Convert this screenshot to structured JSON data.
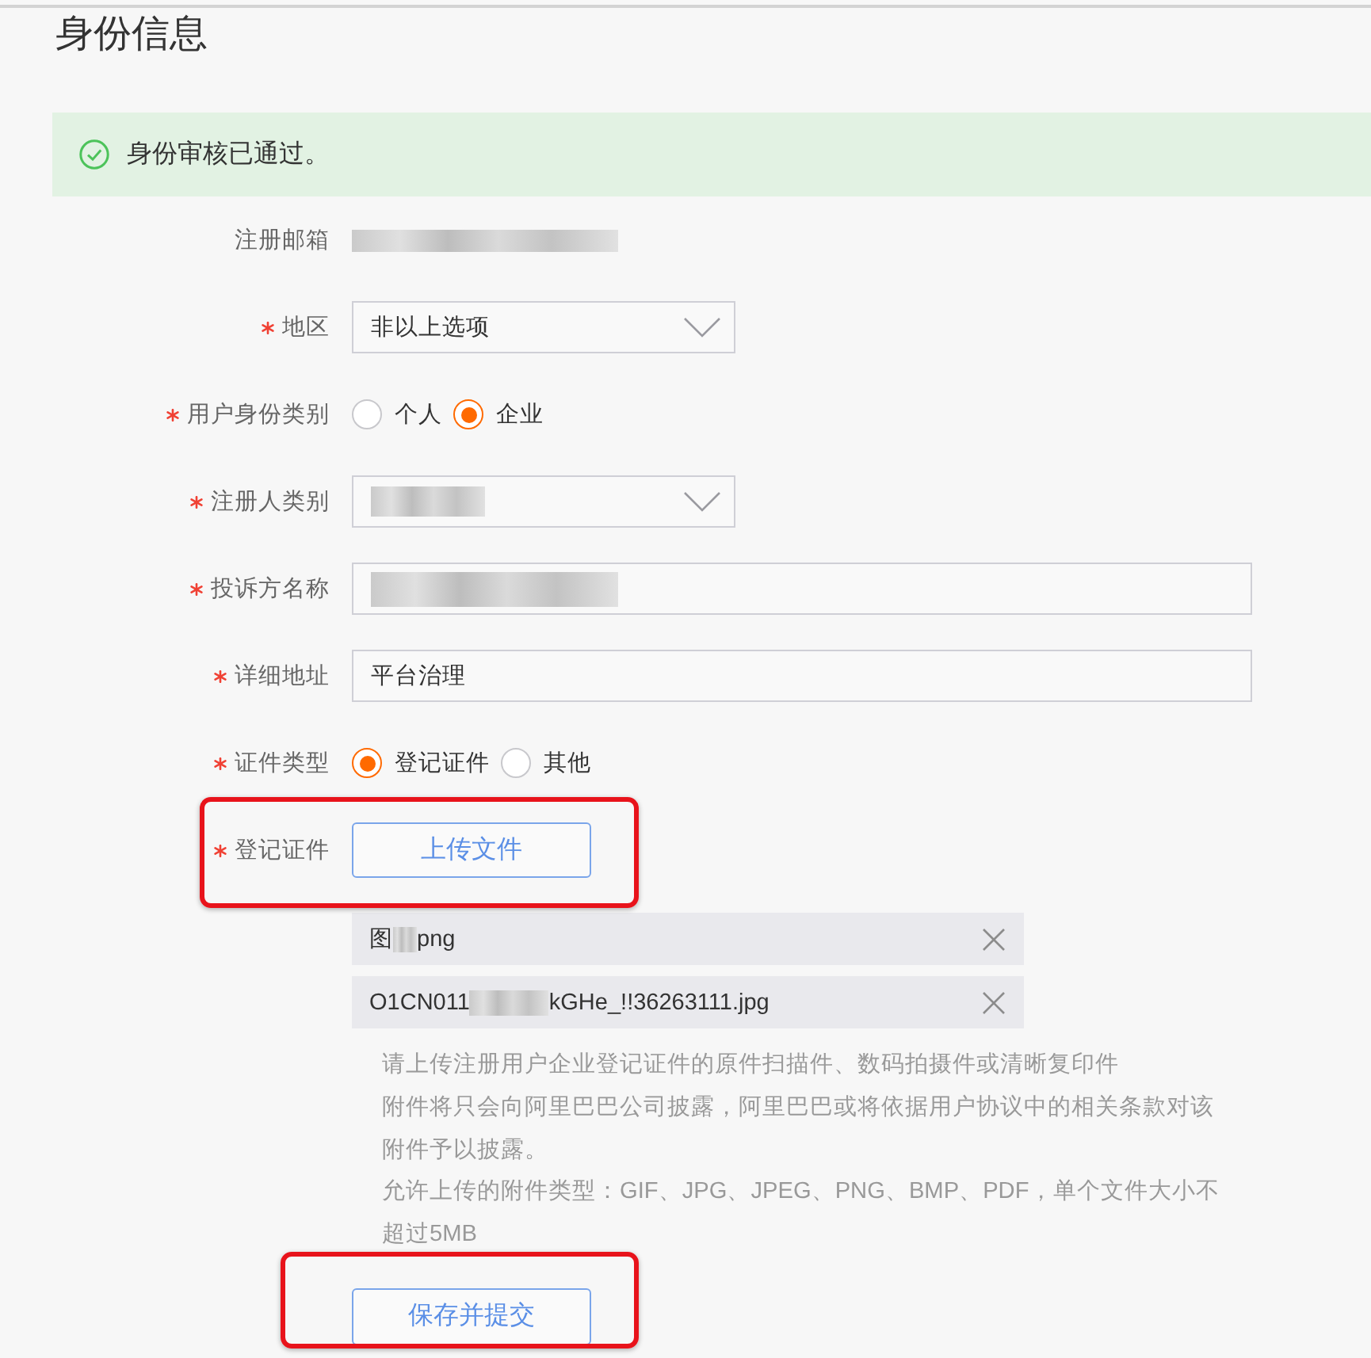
{
  "header": {
    "title": "身份信息"
  },
  "notice": {
    "kind": "success",
    "text": "身份审核已通过。"
  },
  "form": {
    "fields": [
      {
        "kind": "static",
        "label": "注册邮箱",
        "required": false,
        "redacted": true
      },
      {
        "kind": "select",
        "label": "地区",
        "required": true,
        "redacted": false,
        "value": "非以上选项"
      },
      {
        "kind": "radio",
        "label": "用户身份类别",
        "required": true,
        "options": [
          {
            "label": "个人",
            "selected": false
          },
          {
            "label": "企业",
            "selected": true
          }
        ]
      },
      {
        "kind": "select",
        "label": "注册人类别",
        "required": true,
        "redacted": true
      },
      {
        "kind": "text",
        "label": "投诉方名称",
        "required": true,
        "redacted": true
      },
      {
        "kind": "text",
        "label": "详细地址",
        "required": true,
        "redacted": false,
        "value": "平台治理"
      },
      {
        "kind": "radio",
        "label": "证件类型",
        "required": true,
        "options": [
          {
            "label": "登记证件",
            "selected": true
          },
          {
            "label": "其他",
            "selected": false
          }
        ]
      },
      {
        "kind": "upload",
        "label": "登记证件",
        "required": true,
        "highlighted": true,
        "button": "上传文件"
      }
    ],
    "files": [
      {
        "name_parts": [
          "图",
          "png"
        ]
      },
      {
        "name_parts": [
          "O1CN011",
          "kGHe_!!36263111.jpg"
        ]
      }
    ],
    "help": [
      "请上传注册用户企业登记证件的原件扫描件、数码拍摄件或清晰复印件",
      "附件将只会向阿里巴巴公司披露，阿里巴巴或将依据用户协议中的相关条款对该附件予以披露。",
      "允许上传的附件类型：GIF、JPG、JPEG、PNG、BMP、PDF，单个文件大小不超过5MB"
    ]
  },
  "submit": {
    "label": "保存并提交",
    "highlighted": true
  }
}
